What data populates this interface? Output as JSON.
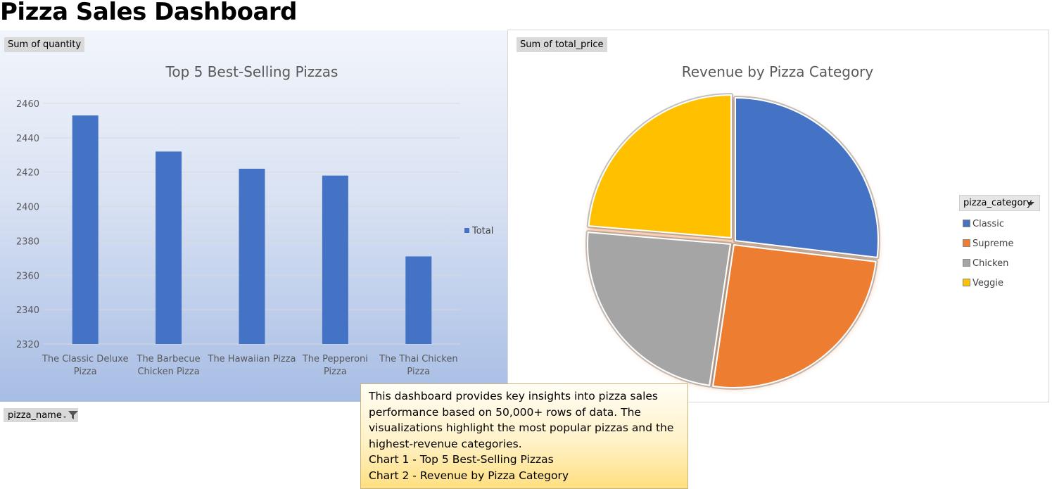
{
  "page": {
    "title": "Pizza Sales Dashboard"
  },
  "chart1": {
    "field_button": "Sum of quantity",
    "filter_button": "pizza_name",
    "legend_label": "Total"
  },
  "chart2": {
    "field_button": "Sum of total_price",
    "legend_header": "pizza_category"
  },
  "textbox": {
    "lines": [
      "This dashboard provides key insights into pizza sales",
      "performance based on 50,000+ rows of data. The",
      "visualizations highlight the most popular pizzas and the",
      "highest-revenue categories.",
      "Chart 1 - Top 5 Best-Selling Pizzas",
      "Chart 2 - Revenue by Pizza Category"
    ]
  },
  "icons": {
    "filter": "funnel-filter-icon",
    "dropdown": "chevron-down-icon"
  },
  "colors": {
    "bar": "#4472c4",
    "classic": "#4472c4",
    "supreme": "#ed7d31",
    "chicken": "#a5a5a5",
    "veggie": "#ffc000"
  },
  "chart_data": [
    {
      "type": "bar",
      "title": "Top 5 Best-Selling Pizzas",
      "categories": [
        [
          "The Classic Deluxe",
          "Pizza"
        ],
        [
          "The Barbecue",
          "Chicken Pizza"
        ],
        [
          "The Hawaiian Pizza"
        ],
        [
          "The Pepperoni",
          "Pizza"
        ],
        [
          "The Thai Chicken",
          "Pizza"
        ]
      ],
      "series": [
        {
          "name": "Total",
          "values": [
            2453,
            2432,
            2422,
            2418,
            2371
          ]
        }
      ],
      "ylim": [
        2320,
        2460
      ],
      "yticks": [
        2320,
        2340,
        2360,
        2380,
        2400,
        2420,
        2440,
        2460
      ],
      "grid": true,
      "legend": "right"
    },
    {
      "type": "pie",
      "title": "Revenue by Pizza Category",
      "labels": [
        "Classic",
        "Supreme",
        "Chicken",
        "Veggie"
      ],
      "values": [
        26.9,
        25.5,
        24.0,
        23.7
      ],
      "colors": [
        "#4472c4",
        "#ed7d31",
        "#a5a5a5",
        "#ffc000"
      ],
      "legend": "right"
    }
  ]
}
